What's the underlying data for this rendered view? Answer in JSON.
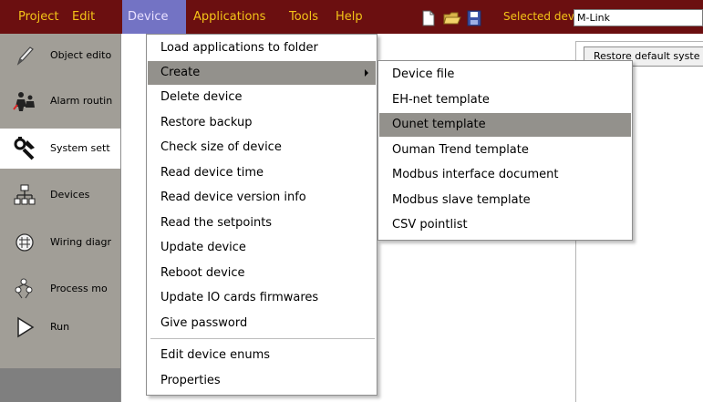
{
  "menubar": {
    "items": [
      "Project",
      "Edit",
      "Device",
      "Applications",
      "Tools",
      "Help"
    ],
    "active": "Device",
    "selected_device_label": "Selected device:",
    "selected_device_value": "M-Link",
    "toolbar_icons": [
      "new-file-icon",
      "open-folder-icon",
      "save-icon"
    ]
  },
  "sidebar": {
    "items": [
      {
        "label": "Object edito",
        "icon": "pen-icon"
      },
      {
        "label": "Alarm routin",
        "icon": "alarm-routing-icon"
      },
      {
        "label": "System sett",
        "icon": "settings-tools-icon"
      },
      {
        "label": "Devices",
        "icon": "devices-network-icon"
      },
      {
        "label": "Wiring diagr",
        "icon": "wiring-diagram-icon"
      },
      {
        "label": "Process mo",
        "icon": "process-monitor-icon"
      },
      {
        "label": "Run",
        "icon": "run-play-icon"
      }
    ],
    "selected_index": 2
  },
  "content": {
    "restore_button": "Restore default syste"
  },
  "device_menu": {
    "items": [
      "Load applications to folder",
      "Create",
      "Delete device",
      "Restore backup",
      "Check size of device",
      "Read device time",
      "Read device version info",
      "Read the setpoints",
      "Update device",
      "Reboot device",
      "Update IO cards firmwares",
      "Give password",
      "Edit device enums",
      "Properties"
    ],
    "highlighted": "Create"
  },
  "create_submenu": {
    "items": [
      "Device file",
      "EH-net template",
      "Ounet template",
      "Ouman Trend template",
      "Modbus interface document",
      "Modbus slave template",
      "CSV pointlist"
    ],
    "highlighted": "Ounet template"
  },
  "colors": {
    "menubar_bg": "#6b0f10",
    "menubar_text": "#f4c418",
    "menu_active_bg": "#7373c4",
    "highlight_bg": "#93918c",
    "sidebar_bg": "#a19e97"
  }
}
